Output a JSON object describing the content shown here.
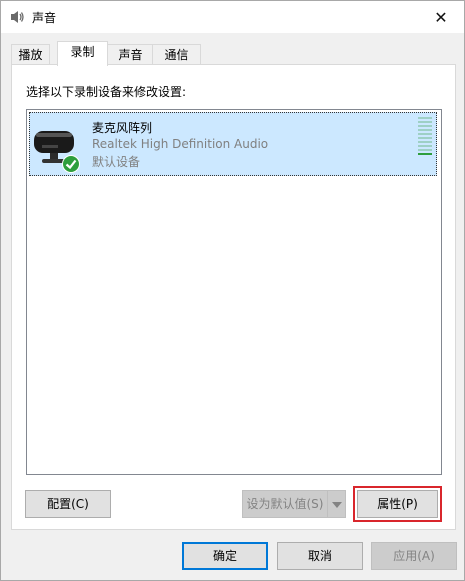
{
  "window": {
    "title": "声音",
    "close_glyph": "✕"
  },
  "tabs": [
    {
      "label": "播放"
    },
    {
      "label": "录制"
    },
    {
      "label": "声音"
    },
    {
      "label": "通信"
    }
  ],
  "recording": {
    "instruction": "选择以下录制设备来修改设置:",
    "devices": [
      {
        "name": "麦克风阵列",
        "driver": "Realtek High Definition Audio",
        "status": "默认设备",
        "icon": "microphone-icon",
        "badge": "default-check-icon",
        "level_fraction": 0.1
      }
    ]
  },
  "buttons": {
    "configure": {
      "label": "配置(C)",
      "enabled": true
    },
    "set_default": {
      "label": "设为默认值(S)",
      "enabled": false
    },
    "properties": {
      "label": "属性(P)",
      "enabled": true
    },
    "ok": {
      "label": "确定",
      "enabled": true
    },
    "cancel": {
      "label": "取消",
      "enabled": true
    },
    "apply": {
      "label": "应用(A)",
      "enabled": false
    }
  },
  "colors": {
    "selection": "#cce8ff",
    "accent": "#0078d7",
    "highlight": "#d9262c",
    "meter_on": "#2e9e3d"
  }
}
